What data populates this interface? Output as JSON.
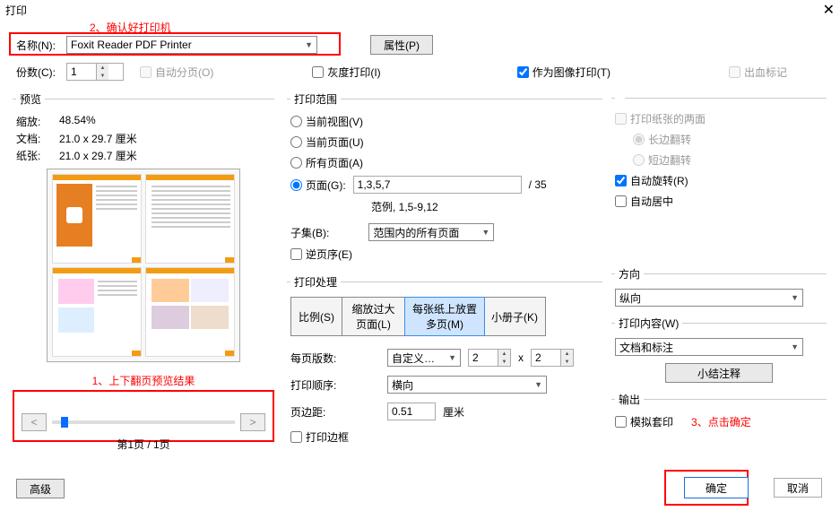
{
  "title": "打印",
  "annotations": {
    "a1": "2、确认好打印机",
    "a2": "1、上下翻页预览结果",
    "a3": "3、点击确定"
  },
  "printer": {
    "name_label": "名称(N):",
    "name_value": "Foxit Reader PDF Printer",
    "properties": "属性(P)",
    "copies_label": "份数(C):",
    "copies_value": "1",
    "collate": "自动分页(O)",
    "grayscale": "灰度打印(I)",
    "as_image": "作为图像打印(T)",
    "bleed": "出血标记"
  },
  "preview": {
    "legend": "预览",
    "zoom_label": "缩放:",
    "zoom_value": "48.54%",
    "doc_label": "文档:",
    "doc_value": "21.0 x 29.7 厘米",
    "paper_label": "纸张:",
    "paper_value": "21.0 x 29.7 厘米",
    "prev": "<",
    "next": ">",
    "page_info": "第1页 / 1页"
  },
  "range": {
    "legend": "打印范围",
    "current_view": "当前视图(V)",
    "current_page": "当前页面(U)",
    "all_pages": "所有页面(A)",
    "pages_label": "页面(G):",
    "pages_value": "1,3,5,7",
    "total": "/ 35",
    "example": "范例, 1,5-9,12",
    "subset_label": "子集(B):",
    "subset_value": "范围内的所有页面",
    "reverse": "逆页序(E)"
  },
  "handling": {
    "legend": "打印处理",
    "seg_scale": "比例(S)",
    "seg_large": "缩放过大页面(L)",
    "seg_multi": "每张纸上放置多页(M)",
    "seg_booklet": "小册子(K)",
    "per_sheet_label": "每页版数:",
    "per_sheet_value": "自定义…",
    "sheet_w": "2",
    "sheet_x": "x",
    "sheet_h": "2",
    "order_label": "打印顺序:",
    "order_value": "横向",
    "margin_label": "页边距:",
    "margin_value": "0.51",
    "margin_unit": "厘米",
    "border": "打印边框"
  },
  "duplex": {
    "both_sides": "打印纸张的两面",
    "flip_long": "长边翻转",
    "flip_short": "短边翻转",
    "auto_rotate": "自动旋转(R)",
    "auto_center": "自动居中"
  },
  "orientation": {
    "legend": "方向",
    "value": "纵向"
  },
  "content": {
    "legend": "打印内容(W)",
    "value": "文档和标注",
    "summarize": "小结注释"
  },
  "output": {
    "legend": "输出",
    "simulate": "模拟套印"
  },
  "buttons": {
    "advanced": "高级",
    "ok": "确定",
    "cancel": "取消"
  }
}
